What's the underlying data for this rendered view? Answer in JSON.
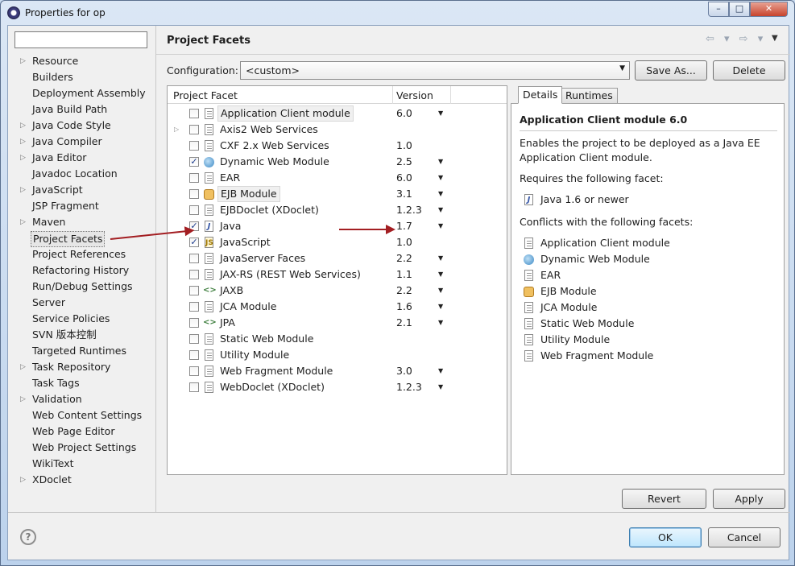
{
  "window": {
    "title": "Properties for op",
    "min": "–",
    "max": "□",
    "close": "✕"
  },
  "left_tree": [
    {
      "label": "Resource",
      "expandable": true
    },
    {
      "label": "Builders",
      "expandable": false
    },
    {
      "label": "Deployment Assembly",
      "expandable": false
    },
    {
      "label": "Java Build Path",
      "expandable": false
    },
    {
      "label": "Java Code Style",
      "expandable": true
    },
    {
      "label": "Java Compiler",
      "expandable": true
    },
    {
      "label": "Java Editor",
      "expandable": true
    },
    {
      "label": "Javadoc Location",
      "expandable": false
    },
    {
      "label": "JavaScript",
      "expandable": true
    },
    {
      "label": "JSP Fragment",
      "expandable": false
    },
    {
      "label": "Maven",
      "expandable": true
    },
    {
      "label": "Project Facets",
      "expandable": false,
      "selected": true
    },
    {
      "label": "Project References",
      "expandable": false
    },
    {
      "label": "Refactoring History",
      "expandable": false
    },
    {
      "label": "Run/Debug Settings",
      "expandable": false
    },
    {
      "label": "Server",
      "expandable": false
    },
    {
      "label": "Service Policies",
      "expandable": false
    },
    {
      "label": "SVN 版本控制",
      "expandable": false
    },
    {
      "label": "Targeted Runtimes",
      "expandable": false
    },
    {
      "label": "Task Repository",
      "expandable": true
    },
    {
      "label": "Task Tags",
      "expandable": false
    },
    {
      "label": "Validation",
      "expandable": true
    },
    {
      "label": "Web Content Settings",
      "expandable": false
    },
    {
      "label": "Web Page Editor",
      "expandable": false
    },
    {
      "label": "Web Project Settings",
      "expandable": false
    },
    {
      "label": "WikiText",
      "expandable": false
    },
    {
      "label": "XDoclet",
      "expandable": true
    }
  ],
  "page": {
    "title": "Project Facets",
    "nav_arrows": "⇦ ▾ ⇨ ▾",
    "nav_menu": "▼",
    "config_label": "Configuration:",
    "config_value": "<custom>",
    "save_as": "Save As...",
    "delete": "Delete",
    "revert": "Revert",
    "apply": "Apply",
    "ok": "OK",
    "cancel": "Cancel",
    "help": "?"
  },
  "facet_table": {
    "headers": [
      "Project Facet",
      "Version"
    ],
    "rows": [
      {
        "name": "Application Client module",
        "version": "6.0",
        "checked": false,
        "icon": "doc-icon",
        "dropdown": true,
        "highlight": true,
        "expandable": false
      },
      {
        "name": "Axis2 Web Services",
        "version": "",
        "checked": false,
        "icon": "doc-icon",
        "dropdown": false,
        "expandable": true
      },
      {
        "name": "CXF 2.x Web Services",
        "version": "1.0",
        "checked": false,
        "icon": "doc-icon",
        "dropdown": false,
        "expandable": false
      },
      {
        "name": "Dynamic Web Module",
        "version": "2.5",
        "checked": true,
        "icon": "globe-icon",
        "dropdown": true,
        "expandable": false
      },
      {
        "name": "EAR",
        "version": "6.0",
        "checked": false,
        "icon": "doc-icon",
        "dropdown": true,
        "expandable": false
      },
      {
        "name": "EJB Module",
        "version": "3.1",
        "checked": false,
        "icon": "ejb-icon",
        "dropdown": true,
        "highlight": true,
        "expandable": false
      },
      {
        "name": "EJBDoclet (XDoclet)",
        "version": "1.2.3",
        "checked": false,
        "icon": "doc-icon",
        "dropdown": true,
        "expandable": false
      },
      {
        "name": "Java",
        "version": "1.7",
        "checked": true,
        "icon": "java-icon",
        "dropdown": true,
        "expandable": false
      },
      {
        "name": "JavaScript",
        "version": "1.0",
        "checked": true,
        "icon": "js-icon",
        "dropdown": false,
        "expandable": false
      },
      {
        "name": "JavaServer Faces",
        "version": "2.2",
        "checked": false,
        "icon": "doc-icon",
        "dropdown": true,
        "expandable": false
      },
      {
        "name": "JAX-RS (REST Web Services)",
        "version": "1.1",
        "checked": false,
        "icon": "doc-icon",
        "dropdown": true,
        "expandable": false
      },
      {
        "name": "JAXB",
        "version": "2.2",
        "checked": false,
        "icon": "xml-icon",
        "dropdown": true,
        "expandable": false
      },
      {
        "name": "JCA Module",
        "version": "1.6",
        "checked": false,
        "icon": "doc-icon",
        "dropdown": true,
        "expandable": false
      },
      {
        "name": "JPA",
        "version": "2.1",
        "checked": false,
        "icon": "xml-icon",
        "dropdown": true,
        "expandable": false
      },
      {
        "name": "Static Web Module",
        "version": "",
        "checked": false,
        "icon": "doc-icon",
        "dropdown": false,
        "expandable": false
      },
      {
        "name": "Utility Module",
        "version": "",
        "checked": false,
        "icon": "doc-icon",
        "dropdown": false,
        "expandable": false
      },
      {
        "name": "Web Fragment Module",
        "version": "3.0",
        "checked": false,
        "icon": "doc-icon",
        "dropdown": true,
        "expandable": false
      },
      {
        "name": "WebDoclet (XDoclet)",
        "version": "1.2.3",
        "checked": false,
        "icon": "doc-icon",
        "dropdown": true,
        "expandable": false
      }
    ]
  },
  "details": {
    "tabs": [
      "Details",
      "Runtimes"
    ],
    "title": "Application Client module 6.0",
    "desc_line1": "Enables the project to be deployed as a Java EE",
    "desc_line2": "Application Client module.",
    "requires_label": "Requires the following facet:",
    "requires": [
      {
        "name": "Java 1.6 or newer",
        "icon": "java-icon"
      }
    ],
    "conflicts_label": "Conflicts with the following facets:",
    "conflicts": [
      {
        "name": "Application Client module",
        "icon": "doc-icon"
      },
      {
        "name": "Dynamic Web Module",
        "icon": "globe-icon"
      },
      {
        "name": "EAR",
        "icon": "doc-icon"
      },
      {
        "name": "EJB Module",
        "icon": "ejb-icon"
      },
      {
        "name": "JCA Module",
        "icon": "doc-icon"
      },
      {
        "name": "Static Web Module",
        "icon": "doc-icon"
      },
      {
        "name": "Utility Module",
        "icon": "doc-icon"
      },
      {
        "name": "Web Fragment Module",
        "icon": "doc-icon"
      }
    ]
  },
  "colors": {
    "arrow": "#a31e22",
    "selection_border": "#777777",
    "accent": "#3a5aa8"
  }
}
